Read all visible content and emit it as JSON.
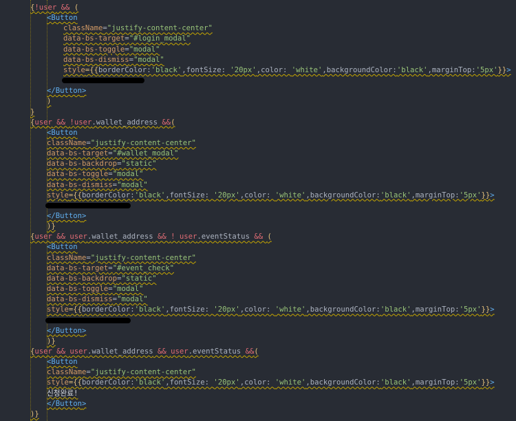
{
  "colors": {
    "background": "#282c34",
    "bracket": "#e5c07b",
    "punct": "#abb2bf",
    "operator": "#e06c75",
    "variable": "#e06c75",
    "tag": "#61afef",
    "attribute": "#d19a66",
    "string": "#98c379",
    "text": "#d7dae0",
    "squiggle": "#c8a800",
    "redaction": "#000000"
  },
  "lines": [
    {
      "indent": 44,
      "tokens": [
        [
          "{",
          "bracket"
        ],
        [
          "!",
          "op"
        ],
        [
          "user",
          "var"
        ],
        [
          " && ",
          "op"
        ],
        [
          "(",
          "bracket"
        ]
      ]
    },
    {
      "indent": 68,
      "tokens": [
        [
          "<",
          "tag"
        ],
        [
          "Button",
          "tag"
        ]
      ]
    },
    {
      "indent": 92,
      "tokens": [
        [
          "className",
          "attr"
        ],
        [
          "=",
          "punct"
        ],
        [
          "\"justify-content-center\"",
          "str"
        ]
      ]
    },
    {
      "indent": 92,
      "tokens": [
        [
          "data-bs-target",
          "attr"
        ],
        [
          "=",
          "punct"
        ],
        [
          "\"#login_modal\"",
          "str"
        ]
      ]
    },
    {
      "indent": 92,
      "tokens": [
        [
          "data-bs-toggle",
          "attr"
        ],
        [
          "=",
          "punct"
        ],
        [
          "\"modal\"",
          "str"
        ]
      ]
    },
    {
      "indent": 92,
      "tokens": [
        [
          "data-bs-dismiss",
          "attr"
        ],
        [
          "=",
          "punct"
        ],
        [
          "\"modal\"",
          "str"
        ]
      ]
    },
    {
      "indent": 92,
      "tokens": [
        [
          "style",
          "attr"
        ],
        [
          "={{",
          "bracket"
        ],
        [
          "borderColor:",
          "prop"
        ],
        [
          "'black'",
          "str"
        ],
        [
          ",fontSize: ",
          "prop"
        ],
        [
          "'20px'",
          "str"
        ],
        [
          ",color: ",
          "prop"
        ],
        [
          "'white'",
          "str"
        ],
        [
          ",backgroundColor:",
          "prop"
        ],
        [
          "'black'",
          "str"
        ],
        [
          ",marginTop:",
          "prop"
        ],
        [
          "'5px'",
          "str"
        ],
        [
          "}}",
          "bracket"
        ],
        [
          ">",
          "tag"
        ]
      ]
    },
    {
      "indent": 92,
      "tokens": [],
      "redacted": true
    },
    {
      "indent": 68,
      "tokens": [
        [
          "</",
          "tag"
        ],
        [
          "Button",
          "tag"
        ],
        [
          ">",
          "tag"
        ]
      ]
    },
    {
      "indent": 68,
      "tokens": [
        [
          ")",
          "bracket"
        ]
      ]
    },
    {
      "indent": 44,
      "tokens": [
        [
          "}",
          "bracket"
        ]
      ]
    },
    {
      "indent": 44,
      "tokens": [
        [
          "{",
          "bracket"
        ],
        [
          "user",
          "var"
        ],
        [
          " && ",
          "op"
        ],
        [
          "!",
          "op"
        ],
        [
          "user",
          "var"
        ],
        [
          ".wallet_address",
          "punct"
        ],
        [
          " &&",
          "op"
        ],
        [
          "(",
          "bracket"
        ]
      ]
    },
    {
      "indent": 68,
      "tokens": [
        [
          "<",
          "tag"
        ],
        [
          "Button",
          "tag"
        ]
      ]
    },
    {
      "indent": 68,
      "tokens": [
        [
          "className",
          "attr"
        ],
        [
          "=",
          "punct"
        ],
        [
          "\"justify-content-center\"",
          "str"
        ]
      ]
    },
    {
      "indent": 68,
      "tokens": [
        [
          "data-bs-target",
          "attr"
        ],
        [
          "=",
          "punct"
        ],
        [
          "\"#wallet_modal\"",
          "str"
        ]
      ]
    },
    {
      "indent": 68,
      "tokens": [
        [
          "data-bs-backdrop",
          "attr"
        ],
        [
          "=",
          "punct"
        ],
        [
          "\"static\"",
          "str"
        ]
      ]
    },
    {
      "indent": 68,
      "tokens": [
        [
          "data-bs-toggle",
          "attr"
        ],
        [
          "=",
          "punct"
        ],
        [
          "\"modal\"",
          "str"
        ]
      ]
    },
    {
      "indent": 68,
      "tokens": [
        [
          "data-bs-dismiss",
          "attr"
        ],
        [
          "=",
          "punct"
        ],
        [
          "\"modal\"",
          "str"
        ]
      ]
    },
    {
      "indent": 68,
      "tokens": [
        [
          "style",
          "attr"
        ],
        [
          "={{",
          "bracket"
        ],
        [
          "borderColor:",
          "prop"
        ],
        [
          "'black'",
          "str"
        ],
        [
          ",fontSize: ",
          "prop"
        ],
        [
          "'20px'",
          "str"
        ],
        [
          ",color: ",
          "prop"
        ],
        [
          "'white'",
          "str"
        ],
        [
          ",backgroundColor:",
          "prop"
        ],
        [
          "'black'",
          "str"
        ],
        [
          ",marginTop:",
          "prop"
        ],
        [
          "'5px'",
          "str"
        ],
        [
          "}}",
          "bracket"
        ],
        [
          ">",
          "tag"
        ]
      ]
    },
    {
      "indent": 68,
      "tokens": [],
      "redacted": true
    },
    {
      "indent": 68,
      "tokens": [
        [
          "</",
          "tag"
        ],
        [
          "Button",
          "tag"
        ],
        [
          ">",
          "tag"
        ]
      ]
    },
    {
      "indent": 68,
      "tokens": [
        [
          ")}",
          "bracket"
        ]
      ]
    },
    {
      "indent": 44,
      "tokens": [
        [
          "{",
          "bracket"
        ],
        [
          "user",
          "var"
        ],
        [
          " && ",
          "op"
        ],
        [
          "user",
          "var"
        ],
        [
          ".wallet_address",
          "punct"
        ],
        [
          " && ",
          "op"
        ],
        [
          "! ",
          "op"
        ],
        [
          "user",
          "var"
        ],
        [
          ".eventStatus",
          "punct"
        ],
        [
          " && ",
          "op"
        ],
        [
          "(",
          "bracket"
        ]
      ]
    },
    {
      "indent": 68,
      "tokens": [
        [
          "<",
          "tag"
        ],
        [
          "Button",
          "tag"
        ]
      ]
    },
    {
      "indent": 68,
      "tokens": [
        [
          "className",
          "attr"
        ],
        [
          "=",
          "punct"
        ],
        [
          "\"justify-content-center\"",
          "str"
        ]
      ]
    },
    {
      "indent": 68,
      "tokens": [
        [
          "data-bs-target",
          "attr"
        ],
        [
          "=",
          "punct"
        ],
        [
          "\"#event_check\"",
          "str"
        ]
      ]
    },
    {
      "indent": 68,
      "tokens": [
        [
          "data-bs-backdrop",
          "attr"
        ],
        [
          "=",
          "punct"
        ],
        [
          "\"static\"",
          "str"
        ]
      ]
    },
    {
      "indent": 68,
      "tokens": [
        [
          "data-bs-toggle",
          "attr"
        ],
        [
          "=",
          "punct"
        ],
        [
          "\"modal\"",
          "str"
        ]
      ]
    },
    {
      "indent": 68,
      "tokens": [
        [
          "data-bs-dismiss",
          "attr"
        ],
        [
          "=",
          "punct"
        ],
        [
          "\"modal\"",
          "str"
        ]
      ]
    },
    {
      "indent": 68,
      "tokens": [
        [
          "style",
          "attr"
        ],
        [
          "={{",
          "bracket"
        ],
        [
          "borderColor:",
          "prop"
        ],
        [
          "'black'",
          "str"
        ],
        [
          ",fontSize: ",
          "prop"
        ],
        [
          "'20px'",
          "str"
        ],
        [
          ",color: ",
          "prop"
        ],
        [
          "'white'",
          "str"
        ],
        [
          ",backgroundColor:",
          "prop"
        ],
        [
          "'black'",
          "str"
        ],
        [
          ",marginTop:",
          "prop"
        ],
        [
          "'5px'",
          "str"
        ],
        [
          "}}",
          "bracket"
        ],
        [
          ">",
          "tag"
        ]
      ]
    },
    {
      "indent": 68,
      "tokens": [],
      "redacted": true
    },
    {
      "indent": 68,
      "tokens": [
        [
          "</",
          "tag"
        ],
        [
          "Button",
          "tag"
        ],
        [
          ">",
          "tag"
        ]
      ]
    },
    {
      "indent": 68,
      "tokens": [
        [
          ")}",
          "bracket"
        ]
      ]
    },
    {
      "indent": 44,
      "tokens": [
        [
          "{",
          "bracket"
        ],
        [
          "user",
          "var"
        ],
        [
          " && ",
          "op"
        ],
        [
          "user",
          "var"
        ],
        [
          ".wallet_address",
          "punct"
        ],
        [
          " && ",
          "op"
        ],
        [
          "user",
          "var"
        ],
        [
          ".eventStatus",
          "punct"
        ],
        [
          " &&",
          "op"
        ],
        [
          "(",
          "bracket"
        ]
      ]
    },
    {
      "indent": 68,
      "tokens": [
        [
          "<",
          "tag"
        ],
        [
          "Button",
          "tag"
        ]
      ]
    },
    {
      "indent": 68,
      "tokens": [
        [
          "className",
          "attr"
        ],
        [
          "=",
          "punct"
        ],
        [
          "\"justify-content-center\"",
          "str"
        ]
      ]
    },
    {
      "indent": 68,
      "tokens": [
        [
          "style",
          "attr"
        ],
        [
          "={{",
          "bracket"
        ],
        [
          "borderColor:",
          "prop"
        ],
        [
          "'black'",
          "str"
        ],
        [
          ",fontSize: ",
          "prop"
        ],
        [
          "'20px'",
          "str"
        ],
        [
          ",color: ",
          "prop"
        ],
        [
          "'white'",
          "str"
        ],
        [
          ",backgroundColor:",
          "prop"
        ],
        [
          "'black'",
          "str"
        ],
        [
          ",marginTop:",
          "prop"
        ],
        [
          "'5px'",
          "str"
        ],
        [
          "}}",
          "bracket"
        ],
        [
          ">",
          "tag"
        ]
      ]
    },
    {
      "indent": 68,
      "tokens": [
        [
          "신청완료!",
          "text"
        ]
      ]
    },
    {
      "indent": 68,
      "tokens": [
        [
          "</",
          "tag"
        ],
        [
          "Button",
          "tag"
        ],
        [
          ">",
          "tag"
        ]
      ]
    },
    {
      "indent": 44,
      "tokens": [
        [
          ")}",
          "bracket"
        ]
      ]
    }
  ]
}
